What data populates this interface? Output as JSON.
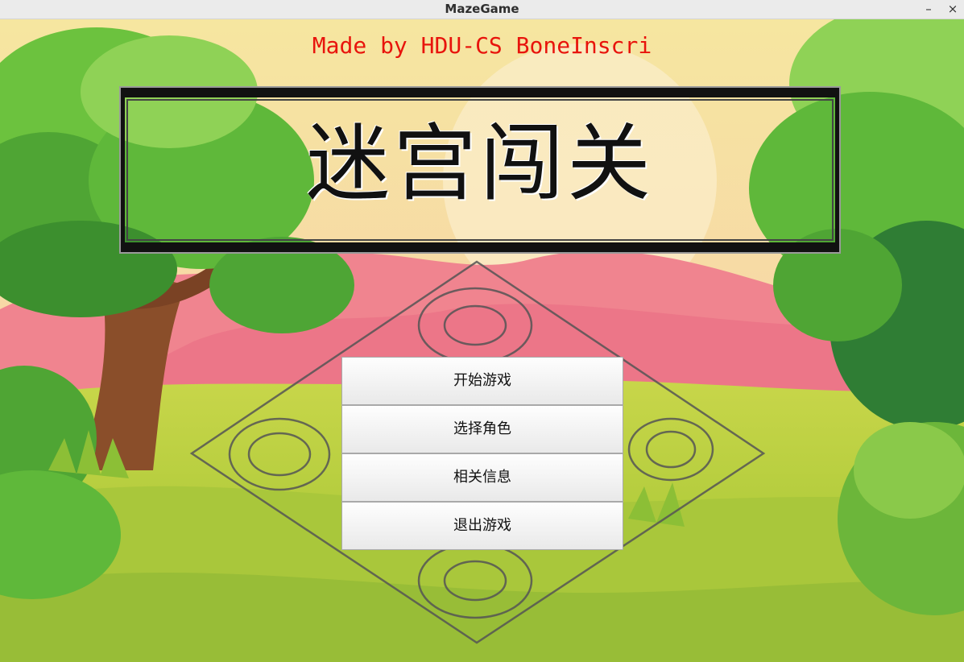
{
  "window": {
    "title": "MazeGame",
    "minimize_label": "–",
    "close_label": "×"
  },
  "header": {
    "credit": "Made by HDU-CS BoneInscri",
    "game_title": "迷宫闯关"
  },
  "menu": {
    "start_label": "开始游戏",
    "select_role_label": "选择角色",
    "info_label": "相关信息",
    "exit_label": "退出游戏"
  },
  "colors": {
    "credit_text": "#e8140c",
    "sky_top": "#f8e7a6",
    "grass": "#9ec43a",
    "tree_green": "#5fb83a",
    "pink_hill": "#f0818c"
  }
}
